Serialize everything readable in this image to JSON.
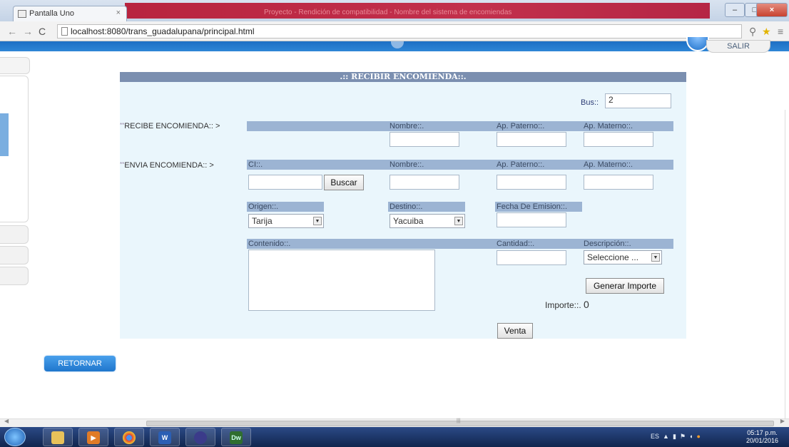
{
  "browser": {
    "tab_title": "Pantalla Uno",
    "tab_close": "×",
    "url": "localhost:8080/trans_guadalupana/principal.html",
    "window_title_faint": "Proyecto - Rendición de compatibilidad - Nombre del sistema de encomiendas"
  },
  "header": {
    "salir_label": "SALIR"
  },
  "form": {
    "title": ".:: RECIBIR ENCOMIENDA::.",
    "bus_label": "Bus::",
    "bus_value": "2",
    "recibe_label": "RECIBE ENCOMIENDA::  >",
    "envia_label": "ENVIA ENCOMIENDA::  >",
    "stars": "**",
    "nombre_label": "Nombre::.",
    "ap_paterno_label": "Ap. Paterno::.",
    "ap_materno_label": "Ap. Materno::.",
    "ci_label": "CI::.",
    "buscar_button": "Buscar",
    "origen_label": "Origen::.",
    "origen_value": "Tarija",
    "destino_label": "Destino::.",
    "destino_value": "Yacuiba",
    "fecha_label": "Fecha De Emision::.",
    "contenido_label": "Contenido::.",
    "cantidad_label": "Cantidad::.",
    "descripcion_label": "Descripción::.",
    "descripcion_value": "Seleccione ...",
    "generar_button": "Generar Importe",
    "importe_label": "Importe::.",
    "importe_value": "0",
    "venta_button": "Venta"
  },
  "retornar_label": "RETORNAR",
  "taskbar": {
    "word_glyph": "W",
    "dw_glyph": "Dw",
    "lang": "ES",
    "time": "05:17 p.m.",
    "date": "20/01/2016"
  }
}
